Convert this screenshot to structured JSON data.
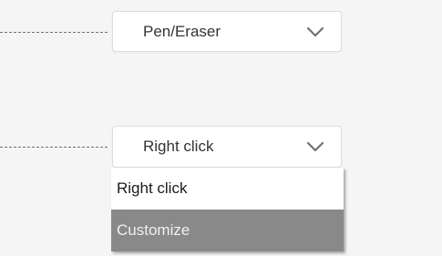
{
  "dropdown_top": {
    "selected": "Pen/Eraser",
    "icon": "chevron-down-icon"
  },
  "dropdown_bottom": {
    "selected": "Right click",
    "icon": "chevron-down-icon",
    "open": true,
    "options": [
      {
        "label": "Right click",
        "highlighted": false
      },
      {
        "label": "Customize",
        "highlighted": true
      }
    ]
  },
  "colors": {
    "background": "#f5f5f5",
    "highlight": "#898989",
    "leader_line": "#6e6e6e"
  }
}
